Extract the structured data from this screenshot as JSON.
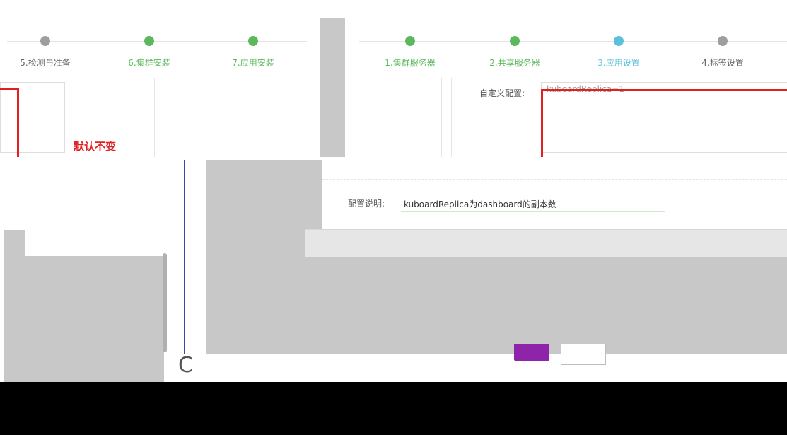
{
  "left_wizard": {
    "steps": [
      {
        "label": "5.检测与准备",
        "state": "pending"
      },
      {
        "label": "6.集群安装",
        "state": "done"
      },
      {
        "label": "7.应用安装",
        "state": "done"
      }
    ],
    "annotation": "默认不变"
  },
  "right_wizard": {
    "steps": [
      {
        "label": "1.集群服务器",
        "state": "done"
      },
      {
        "label": "2.共享服务器",
        "state": "done"
      },
      {
        "label": "3.应用设置",
        "state": "active"
      },
      {
        "label": "4.标签设置",
        "state": "pending"
      }
    ],
    "custom_config_label": "自定义配置:",
    "custom_config_value": "kuboardReplica=1",
    "config_desc_label": "配置说明:",
    "config_desc_value": "kuboardReplica为dashboard的副本数"
  },
  "colors": {
    "done": "#5cb85c",
    "active": "#5bc0de",
    "pending": "#9e9e9e",
    "annotation": "#e12121",
    "purple_button": "#8e24aa"
  }
}
